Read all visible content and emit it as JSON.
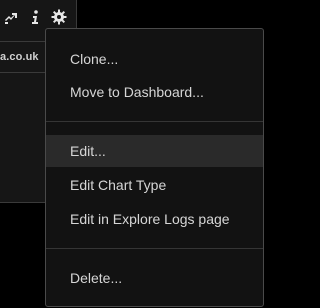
{
  "toolbar": {
    "icons": [
      "pin-icon",
      "info-icon",
      "gear-icon"
    ]
  },
  "panel": {
    "domain_text": "a.co.uk"
  },
  "menu": {
    "items": [
      {
        "label": "Clone..."
      },
      {
        "label": "Move to Dashboard..."
      },
      {
        "label": "Edit..."
      },
      {
        "label": "Edit Chart Type"
      },
      {
        "label": "Edit in Explore Logs page"
      },
      {
        "label": "Delete..."
      }
    ],
    "highlighted": "Edit..."
  },
  "colors": {
    "menu_bg": "#121212",
    "menu_border": "#4a4a4a",
    "hover_bg": "#2a2a2a",
    "text": "#d6d6d6"
  }
}
